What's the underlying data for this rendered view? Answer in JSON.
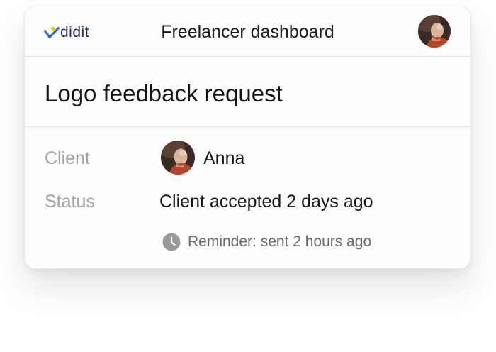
{
  "header": {
    "logo_text": "didit",
    "title": "Freelancer dashboard",
    "user_avatar_icon": "user-avatar"
  },
  "request": {
    "title": "Logo feedback request"
  },
  "details": {
    "client_label": "Client",
    "client_name": "Anna",
    "client_avatar_icon": "client-avatar",
    "status_label": "Status",
    "status_value": "Client accepted 2 days ago",
    "reminder_icon": "clock-icon",
    "reminder_text": "Reminder: sent 2 hours ago"
  },
  "colors": {
    "brand_blue": "#2f6fd6",
    "brand_yellow": "#f2b51c",
    "brand_text": "#1f2b5a",
    "muted_label": "#a3a3a3",
    "body_text": "#161616"
  }
}
